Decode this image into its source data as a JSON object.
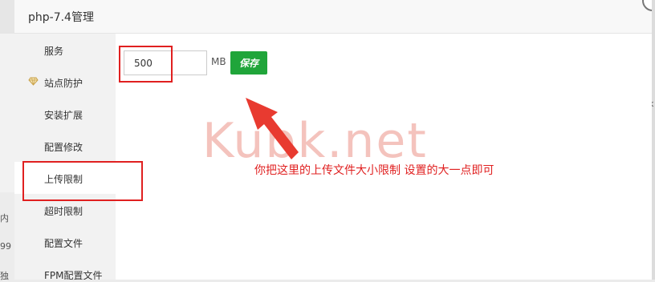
{
  "background": {
    "left_fragments": [
      "内",
      "99",
      "独"
    ],
    "right_fragment": "k"
  },
  "modal": {
    "title": "php-7.4管理"
  },
  "sidebar": {
    "items": [
      {
        "label": "服务"
      },
      {
        "label": "站点防护",
        "icon": "diamond-icon"
      },
      {
        "label": "安装扩展"
      },
      {
        "label": "配置修改"
      },
      {
        "label": "上传限制"
      },
      {
        "label": "超时限制"
      },
      {
        "label": "配置文件"
      },
      {
        "label": "FPM配置文件"
      }
    ]
  },
  "upload": {
    "value": "500",
    "unit": "MB",
    "save_label": "保存"
  },
  "overlay": {
    "watermark": "Kubk.net",
    "annotation": "你把这里的上传文件大小限制 设置的大一点即可",
    "annotation_color": "#e02020"
  },
  "colors": {
    "accent": "#20a53a",
    "highlight": "#e02020"
  }
}
